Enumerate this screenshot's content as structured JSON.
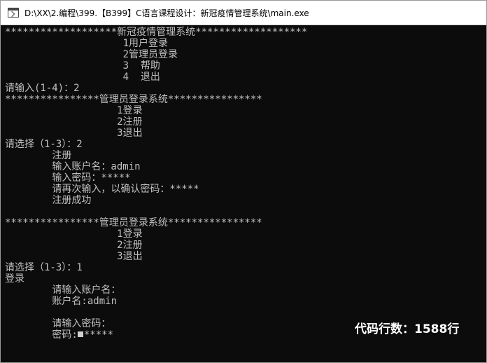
{
  "window": {
    "title": "D:\\XX\\2.编程\\399.【B399】C语言课程设计：新冠疫情管理系统\\main.exe"
  },
  "console": {
    "lines": [
      "*******************新冠疫情管理系统*******************",
      "                    1用户登录",
      "                    2管理员登录",
      "                    3  帮助",
      "                    4  退出",
      "请输入(1-4)：2",
      "****************管理员登录系统****************",
      "                   1登录",
      "                   2注册",
      "                   3退出",
      "请选择（1-3）：2",
      "        注册",
      "        输入账户名：admin",
      "        输入密码：*****",
      "        请再次输入，以确认密码：*****",
      "        注册成功",
      "",
      "****************管理员登录系统****************",
      "                   1登录",
      "                   2注册",
      "                   3退出",
      "请选择（1-3）：1",
      "登录",
      "        请输入账户名：",
      "        账户名:admin",
      "",
      "        请输入密码：",
      "        密码:",
      "*****"
    ]
  },
  "overlay": {
    "watermark": "代码行数：1588行"
  }
}
